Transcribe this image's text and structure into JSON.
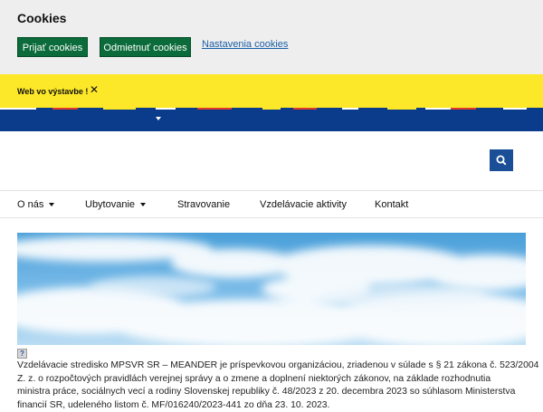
{
  "cookies": {
    "title": "Cookies",
    "accept_label": "Prijať cookies",
    "reject_label": "Odmietnuť cookies",
    "settings_label": "Nastavenia cookies"
  },
  "notice": {
    "text": "Web vo výstavbe !",
    "close_glyph": "✕"
  },
  "nav": {
    "items": [
      {
        "label": "O nás",
        "has_dropdown": true
      },
      {
        "label": "Ubytovanie",
        "has_dropdown": true
      },
      {
        "label": "Stravovanie",
        "has_dropdown": false
      },
      {
        "label": "Vzdelávacie aktivity",
        "has_dropdown": false
      },
      {
        "label": "Kontakt",
        "has_dropdown": false
      }
    ]
  },
  "icons": {
    "search": "search-icon",
    "close": "close-icon",
    "caret": "chevron-down-icon",
    "help": "question-icon"
  },
  "help_glyph": "?",
  "intro": {
    "lines": [
      "Vzdelávacie stredisko MPSVR SR – MEANDER je príspevkovou organizáciou, zriadenou v súlade s § 21 zákona č. 523/2004",
      "Z. z. o rozpočtových pravidlách verejnej správy a o zmene a doplnení niektorých zákonov, na základe rozhodnutia",
      "ministra práce, sociálnych vecí a rodiny Slovenskej republiky č. 48/2023 z 20. decembra 2023 so súhlasom Ministerstva",
      "financií SR, udeleného listom č. MF/016240/2023-441 zo dňa 23. 10. 2023."
    ]
  },
  "colors": {
    "accent_green": "#0b6b3a",
    "notice_yellow": "#fce729",
    "brand_blue": "#0b3c8c",
    "search_blue": "#1a4e96",
    "stripe_red": "#e03a2a",
    "stripe_yellow": "#fce729"
  }
}
